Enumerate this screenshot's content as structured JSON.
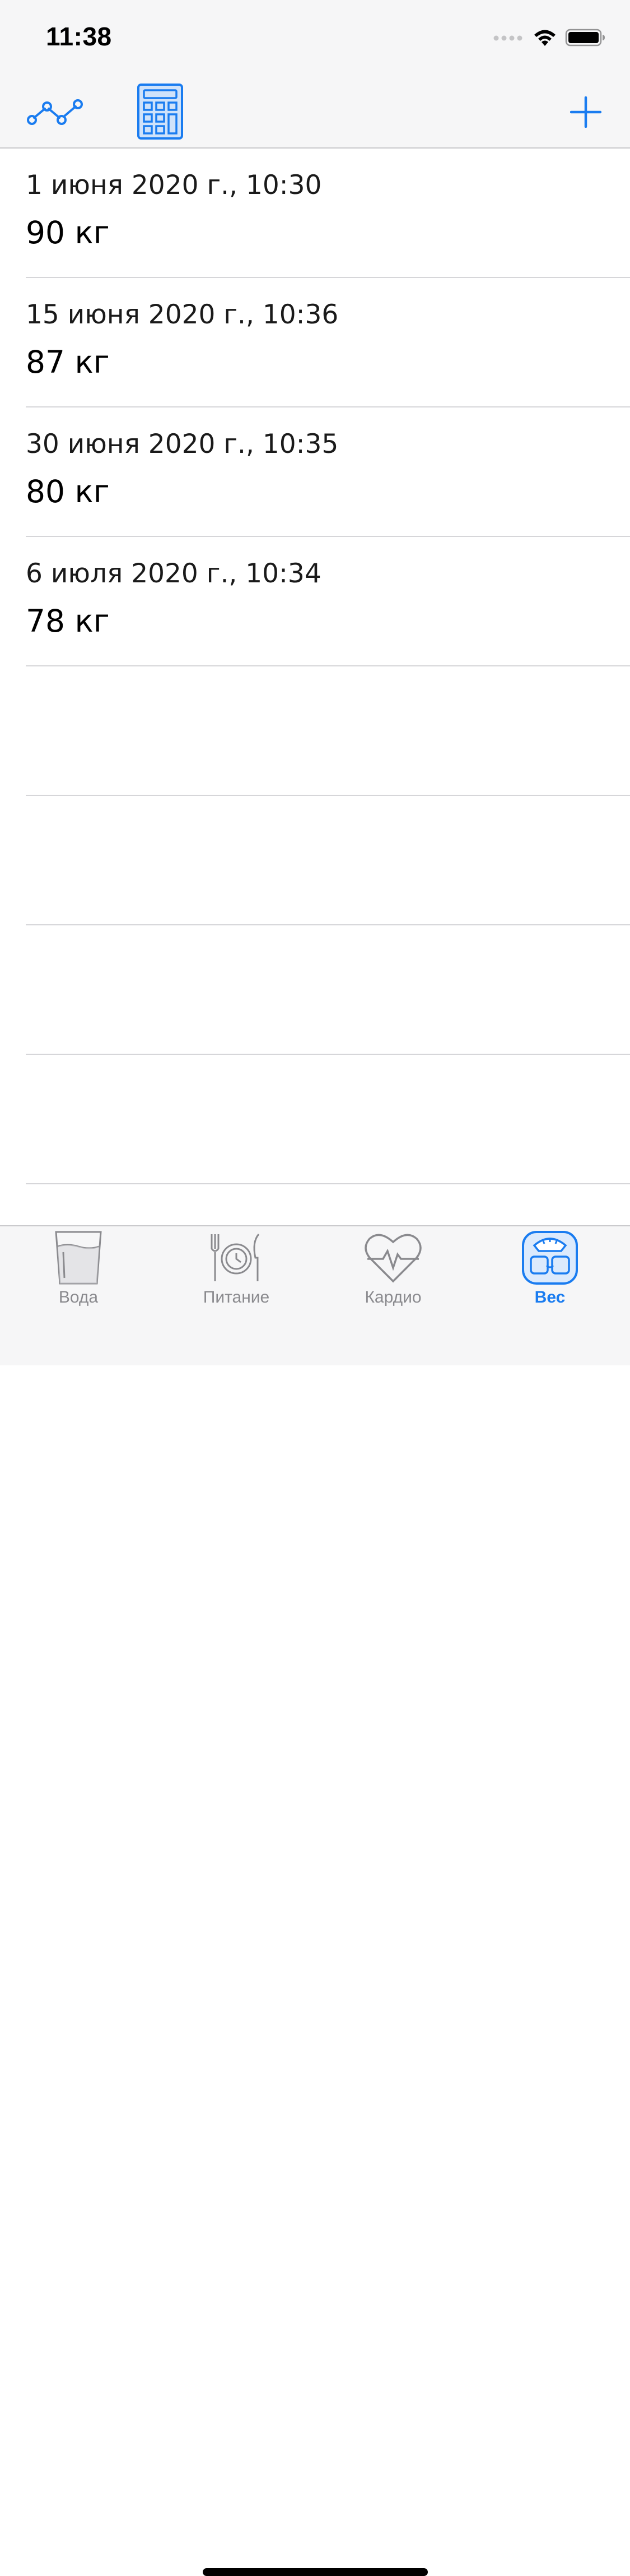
{
  "status_bar": {
    "time": "11:38",
    "icons": [
      "cellular-dots-icon",
      "wifi-icon",
      "battery-icon"
    ]
  },
  "nav_bar": {
    "buttons": [
      "chart-icon",
      "calculator-icon",
      "add-icon"
    ],
    "accent_color": "#1a7cf0"
  },
  "entries": [
    {
      "date": "1 июня 2020 г., 10:30",
      "weight": "90 кг"
    },
    {
      "date": "15 июня 2020 г., 10:36",
      "weight": "87 кг"
    },
    {
      "date": "30 июня 2020 г., 10:35",
      "weight": "80 кг"
    },
    {
      "date": "6 июля 2020 г., 10:34",
      "weight": "78 кг"
    }
  ],
  "tab_bar": {
    "tabs": [
      {
        "label": "Вода",
        "icon": "water-glass-icon",
        "active": false
      },
      {
        "label": "Питание",
        "icon": "plate-cutlery-icon",
        "active": false
      },
      {
        "label": "Кардио",
        "icon": "heart-pulse-icon",
        "active": false
      },
      {
        "label": "Вес",
        "icon": "scale-icon",
        "active": true
      }
    ],
    "inactive_color": "#8a8a8e",
    "active_color": "#1a7cf0"
  }
}
